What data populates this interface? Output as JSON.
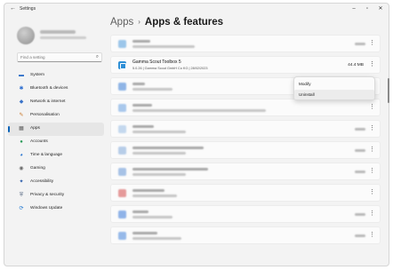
{
  "window": {
    "title": "Settings",
    "controls": [
      "–",
      "▫",
      "✕"
    ],
    "back_glyph": "←"
  },
  "sidebar": {
    "search_placeholder": "Find a setting",
    "search_icon": "⌕",
    "items": [
      {
        "label": "System",
        "icon": "system-icon",
        "glyph": "▬",
        "color": "#2a6cc7"
      },
      {
        "label": "Bluetooth & devices",
        "icon": "bluetooth-icon",
        "glyph": "✱",
        "color": "#2f6fd0"
      },
      {
        "label": "Network & internet",
        "icon": "network-icon",
        "glyph": "◆",
        "color": "#3a73c9"
      },
      {
        "label": "Personalisation",
        "icon": "brush-icon",
        "glyph": "✎",
        "color": "#c9782a"
      },
      {
        "label": "Apps",
        "icon": "apps-icon",
        "glyph": "▦",
        "color": "#5a5a5a",
        "active": true
      },
      {
        "label": "Accounts",
        "icon": "accounts-icon",
        "glyph": "●",
        "color": "#2a9a58"
      },
      {
        "label": "Time & language",
        "icon": "time-icon",
        "glyph": "◕",
        "color": "#2f79d1"
      },
      {
        "label": "Gaming",
        "icon": "gaming-icon",
        "glyph": "◉",
        "color": "#6b6b6b"
      },
      {
        "label": "Accessibility",
        "icon": "accessibility-icon",
        "glyph": "✦",
        "color": "#2457a8"
      },
      {
        "label": "Privacy & security",
        "icon": "shield-icon",
        "glyph": "⛨",
        "color": "#5a6b85"
      },
      {
        "label": "Windows Update",
        "icon": "windows-update-icon",
        "glyph": "⟳",
        "color": "#1f78d1"
      }
    ]
  },
  "breadcrumb": {
    "parent": "Apps",
    "separator": "›",
    "current": "Apps & features"
  },
  "apps": {
    "selected": {
      "name": "Gamma Scout Toolbox 5",
      "meta": "5.0.26  |  Gamma Scout GmbH Co KG  |  28/02/2023",
      "size": "44.4 MB"
    }
  },
  "context_menu": {
    "items": [
      "Modify",
      "Uninstall"
    ]
  },
  "colors": {
    "accent": "#0a63b8"
  }
}
